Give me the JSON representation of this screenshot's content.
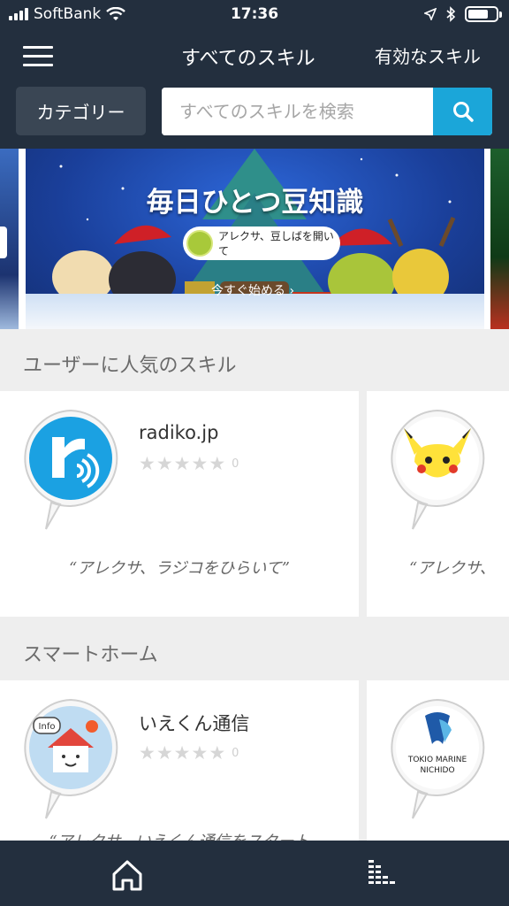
{
  "status_bar": {
    "carrier": "SoftBank",
    "time": "17:36"
  },
  "header": {
    "nav_all": "すべてのスキル",
    "nav_enabled": "有効なスキル",
    "category_button": "カテゴリー",
    "search_placeholder": "すべてのスキルを検索"
  },
  "banner": {
    "title": "毎日ひとつ豆知識",
    "bubble_text": "アレクサ、豆しばを開いて",
    "cta": "今すぐ始める ›"
  },
  "sections": [
    {
      "title": "ユーザーに人気のスキル",
      "cards": [
        {
          "name": "radiko.jp",
          "rating_count": "0",
          "phrase": "“アレクサ、ラジコをひらいて”",
          "icon": "radiko-logo-icon",
          "icon_color": "#1ba1e2"
        },
        {
          "phrase": "“アレクサ、",
          "icon": "pikachu-icon",
          "icon_color": "#ffe23a"
        }
      ]
    },
    {
      "title": "スマートホーム",
      "cards": [
        {
          "name": "いえくん通信",
          "rating_count": "0",
          "phrase": "“アレクサ、いえくん通信をスタート",
          "icon": "iekun-house-icon",
          "icon_badge": "Info",
          "icon_color": "#bfdcf2"
        },
        {
          "icon": "tokio-marine-icon",
          "icon_text_1": "TOKIO MARINE",
          "icon_text_2": "NICHIDO",
          "icon_color": "#1f5aa8"
        }
      ]
    }
  ],
  "bottom_nav": {
    "items": [
      "home-icon",
      "activity-feed-icon"
    ]
  },
  "colors": {
    "header_bg": "#232f3e",
    "accent": "#1ba6d9",
    "page_bg": "#eeeeee"
  }
}
